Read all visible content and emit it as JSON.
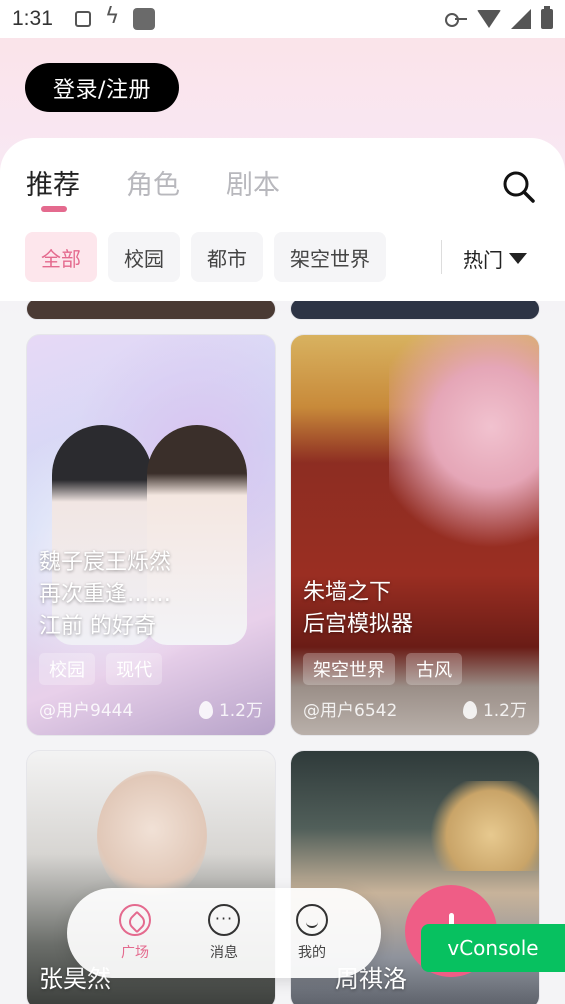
{
  "statusbar": {
    "time": "1:31"
  },
  "header": {
    "login_label": "登录/注册"
  },
  "tabs": [
    {
      "label": "推荐",
      "active": true
    },
    {
      "label": "角色",
      "active": false
    },
    {
      "label": "剧本",
      "active": false
    }
  ],
  "filters": {
    "chips": [
      {
        "label": "全部",
        "active": true
      },
      {
        "label": "校园",
        "active": false
      },
      {
        "label": "都市",
        "active": false
      },
      {
        "label": "架空世界",
        "active": false
      }
    ],
    "sort_label": "热门"
  },
  "cards": [
    {
      "title_lines": [
        "魏子宸王烁然",
        "再次重逢……",
        "江前 的好奇"
      ],
      "tags": [
        "校园",
        "现代"
      ],
      "author": "@用户9444",
      "heat": "1.2万"
    },
    {
      "title_lines": [
        "朱墙之下",
        "后宫模拟器"
      ],
      "tags": [
        "架空世界",
        "古风"
      ],
      "author": "@用户6542",
      "heat": "1.2万"
    },
    {
      "title_lines": [
        "张昊然"
      ]
    },
    {
      "title_lines": [
        "周祺洛"
      ]
    }
  ],
  "bottom_nav": [
    {
      "label": "广场",
      "icon": "compass-icon",
      "active": true
    },
    {
      "label": "消息",
      "icon": "message-icon",
      "active": false
    },
    {
      "label": "我的",
      "icon": "smile-icon",
      "active": false
    }
  ],
  "vconsole_label": "vConsole",
  "colors": {
    "accent": "#e46a8e",
    "fab": "#ef5d86",
    "vconsole": "#07c160"
  }
}
